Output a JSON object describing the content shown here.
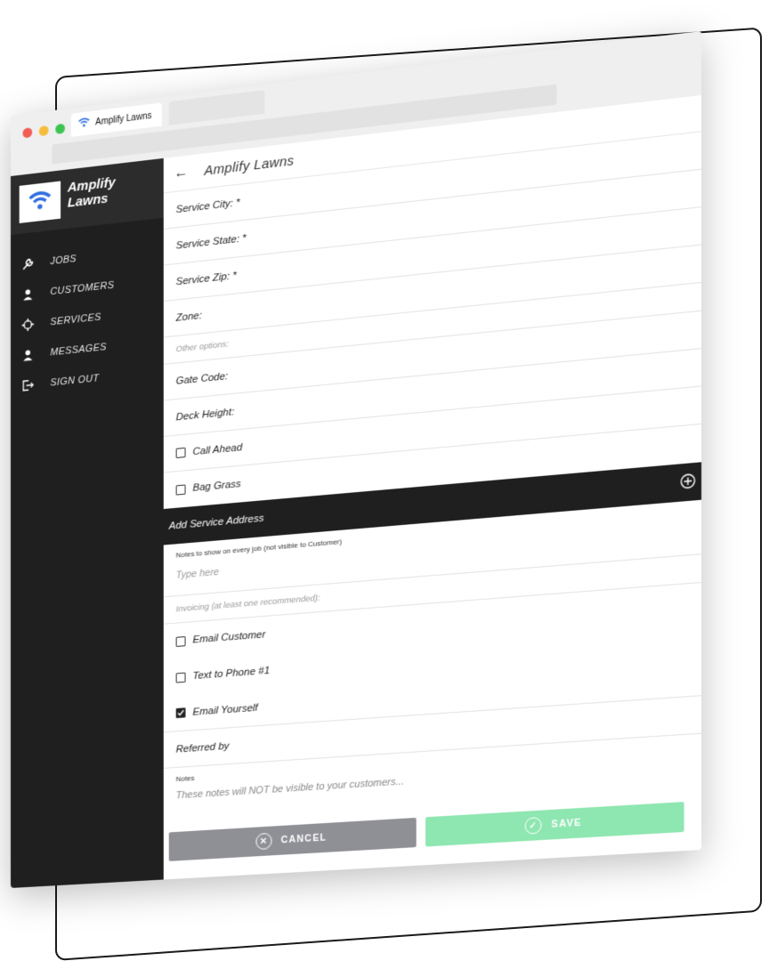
{
  "tab": {
    "title": "Amplify Lawns"
  },
  "sidebar": {
    "brand": "Amplify Lawns",
    "items": [
      {
        "label": "JOBS",
        "icon": "wrench-icon"
      },
      {
        "label": "CUSTOMERS",
        "icon": "person-icon"
      },
      {
        "label": "SERVICES",
        "icon": "crosshair-icon"
      },
      {
        "label": "MESSAGES",
        "icon": "person-icon"
      },
      {
        "label": "SIGN OUT",
        "icon": "sign-out-icon"
      }
    ]
  },
  "header": {
    "title": "Amplify Lawns"
  },
  "form": {
    "service_city": "Service City: *",
    "service_state": "Service State: *",
    "service_zip": "Service Zip: *",
    "zone": "Zone:",
    "other_options": "Other options:",
    "gate_code": "Gate Code:",
    "deck_height": "Deck Height:",
    "call_ahead": "Call Ahead",
    "bag_grass": "Bag Grass",
    "add_service_address": "Add Service Address",
    "job_notes_label": "Notes to show on every job (not visible to Customer)",
    "job_notes_placeholder": "Type here",
    "invoicing_label": "Invoicing (at least one recommended):",
    "email_customer": "Email Customer",
    "text_phone": "Text to Phone #1",
    "email_yourself": "Email Yourself",
    "email_yourself_checked": true,
    "referred_by": "Referred by",
    "notes_label": "Notes",
    "notes_placeholder": "These notes will NOT be visible to your customers..."
  },
  "buttons": {
    "cancel": "CANCEL",
    "save": "SAVE"
  },
  "colors": {
    "sidebar": "#1f1f1f",
    "save": "#8ee6b0",
    "cancel": "#8f8f96",
    "logo": "#2f6fe0"
  }
}
